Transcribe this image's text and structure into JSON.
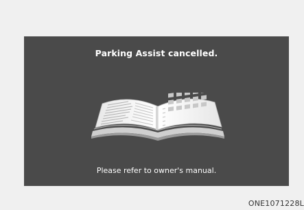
{
  "screen": {
    "title": "Parking Assist cancelled.",
    "message": "Please refer to owner's manual.",
    "illustration_icon": "open-book-icon",
    "background_color": "#4a4a4a",
    "text_color": "#ffffff"
  },
  "figure_code": "ONE1071228L"
}
